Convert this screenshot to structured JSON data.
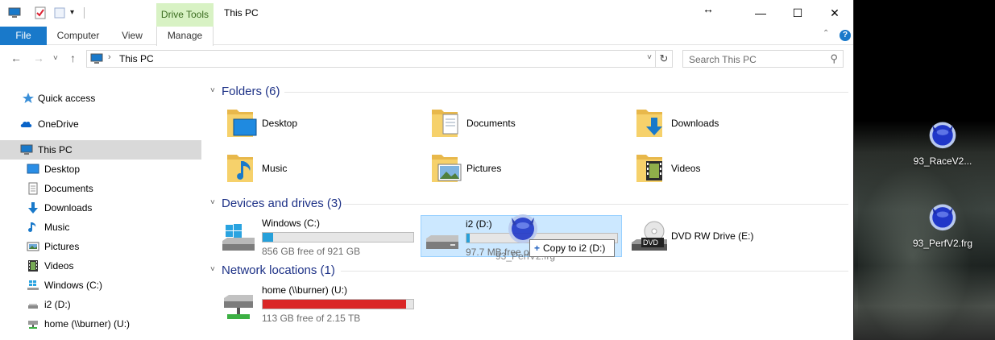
{
  "window": {
    "title": "This PC",
    "contextual_tab": "Drive Tools",
    "ribbon_tabs": [
      "File",
      "Computer",
      "View",
      "Manage"
    ]
  },
  "address": {
    "path": "This PC",
    "search_placeholder": "Search This PC"
  },
  "navpane": {
    "items": [
      {
        "label": "Quick access",
        "icon": "star-icon"
      },
      {
        "label": "OneDrive",
        "icon": "cloud-icon"
      },
      {
        "label": "This PC",
        "icon": "computer-icon"
      },
      {
        "label": "Desktop",
        "icon": "desktop-icon"
      },
      {
        "label": "Documents",
        "icon": "documents-icon"
      },
      {
        "label": "Downloads",
        "icon": "download-arrow-icon"
      },
      {
        "label": "Music",
        "icon": "music-note-icon"
      },
      {
        "label": "Pictures",
        "icon": "pictures-icon"
      },
      {
        "label": "Videos",
        "icon": "film-icon"
      },
      {
        "label": "Windows (C:)",
        "icon": "windows-drive-icon"
      },
      {
        "label": "i2 (D:)",
        "icon": "drive-icon"
      },
      {
        "label": "home (\\\\burner) (U:)",
        "icon": "network-drive-icon"
      }
    ]
  },
  "groups": {
    "folders": "Folders (6)",
    "drives": "Devices and drives (3)",
    "network": "Network locations (1)"
  },
  "folders": [
    {
      "label": "Desktop"
    },
    {
      "label": "Documents"
    },
    {
      "label": "Downloads"
    },
    {
      "label": "Music"
    },
    {
      "label": "Pictures"
    },
    {
      "label": "Videos"
    }
  ],
  "drives": [
    {
      "name": "Windows (C:)",
      "free": "856 GB free of 921 GB",
      "used_fraction": 0.07,
      "bar_color": "#26a0da"
    },
    {
      "name": "i2 (D:)",
      "free": "97.7 MB free of",
      "used_fraction": 0.02,
      "bar_color": "#26a0da"
    },
    {
      "name": "DVD RW Drive (E:)"
    }
  ],
  "network": [
    {
      "name": "home (\\\\burner) (U:)",
      "free": "113 GB free of 2.15 TB",
      "used_fraction": 0.95,
      "bar_color": "#da2626"
    }
  ],
  "drag": {
    "tooltip_action": "Copy to i2 (D:)",
    "ghost_label": "93_PerfV2.frg"
  },
  "desktop_icons": [
    {
      "label": "93_RaceV2..."
    },
    {
      "label": "93_PerfV2.frg"
    }
  ]
}
